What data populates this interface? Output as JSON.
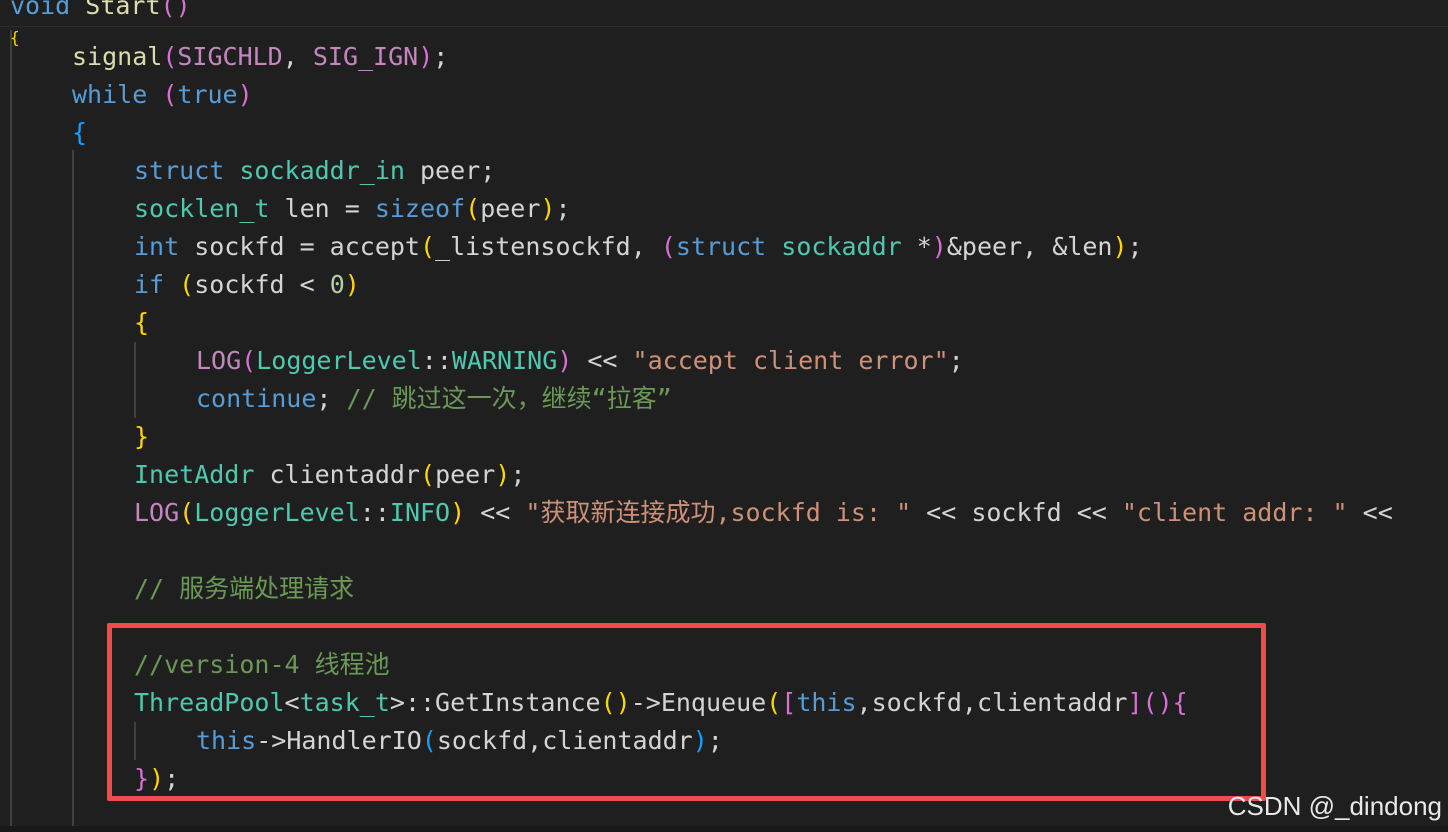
{
  "editor": {
    "lines": [
      {
        "tokens": [
          {
            "t": "void",
            "c": "kw"
          },
          {
            "t": " Start",
            "c": "fn"
          },
          {
            "t": "()",
            "c": "p2"
          }
        ]
      },
      {
        "tokens": [
          {
            "t": "{",
            "c": "p1"
          }
        ]
      },
      {
        "tokens": [
          {
            "t": "signal",
            "c": "fn"
          },
          {
            "t": "(",
            "c": "p2"
          },
          {
            "t": "SIGCHLD",
            "c": "ctl"
          },
          {
            "t": ", ",
            "c": "pl"
          },
          {
            "t": "SIG_IGN",
            "c": "ctl"
          },
          {
            "t": ")",
            "c": "p2"
          },
          {
            "t": ";",
            "c": "pl"
          }
        ]
      },
      {
        "tokens": [
          {
            "t": "while",
            "c": "kw"
          },
          {
            "t": " ",
            "c": "pl"
          },
          {
            "t": "(",
            "c": "p2"
          },
          {
            "t": "true",
            "c": "kw"
          },
          {
            "t": ")",
            "c": "p2"
          }
        ]
      },
      {
        "tokens": [
          {
            "t": "{",
            "c": "p3"
          }
        ]
      },
      {
        "tokens": [
          {
            "t": "struct",
            "c": "kw"
          },
          {
            "t": " ",
            "c": "pl"
          },
          {
            "t": "sockaddr_in",
            "c": "ty"
          },
          {
            "t": " peer;",
            "c": "pl"
          }
        ]
      },
      {
        "tokens": [
          {
            "t": "socklen_t",
            "c": "ty"
          },
          {
            "t": " len = ",
            "c": "pl"
          },
          {
            "t": "sizeof",
            "c": "kw"
          },
          {
            "t": "(",
            "c": "p1"
          },
          {
            "t": "peer",
            "c": "pl"
          },
          {
            "t": ")",
            "c": "p1"
          },
          {
            "t": ";",
            "c": "pl"
          }
        ]
      },
      {
        "tokens": [
          {
            "t": "int",
            "c": "kw"
          },
          {
            "t": " sockfd = accept",
            "c": "pl"
          },
          {
            "t": "(",
            "c": "p1"
          },
          {
            "t": "_listensockfd, ",
            "c": "pl"
          },
          {
            "t": "(",
            "c": "p2"
          },
          {
            "t": "struct",
            "c": "kw"
          },
          {
            "t": " ",
            "c": "pl"
          },
          {
            "t": "sockaddr",
            "c": "ty"
          },
          {
            "t": " *",
            "c": "pl"
          },
          {
            "t": ")",
            "c": "p2"
          },
          {
            "t": "&peer, &len",
            "c": "pl"
          },
          {
            "t": ")",
            "c": "p1"
          },
          {
            "t": ";",
            "c": "pl"
          }
        ]
      },
      {
        "tokens": [
          {
            "t": "if",
            "c": "kw"
          },
          {
            "t": " ",
            "c": "pl"
          },
          {
            "t": "(",
            "c": "p1"
          },
          {
            "t": "sockfd < ",
            "c": "pl"
          },
          {
            "t": "0",
            "c": "num"
          },
          {
            "t": ")",
            "c": "p1"
          }
        ]
      },
      {
        "tokens": [
          {
            "t": "{",
            "c": "p1"
          }
        ]
      },
      {
        "tokens": [
          {
            "t": "LOG",
            "c": "ctl"
          },
          {
            "t": "(",
            "c": "p2"
          },
          {
            "t": "LoggerLevel",
            "c": "ty"
          },
          {
            "t": "::",
            "c": "pl"
          },
          {
            "t": "WARNING",
            "c": "ty"
          },
          {
            "t": ")",
            "c": "p2"
          },
          {
            "t": " << ",
            "c": "pl"
          },
          {
            "t": "\"accept client error\"",
            "c": "str"
          },
          {
            "t": ";",
            "c": "pl"
          }
        ]
      },
      {
        "tokens": [
          {
            "t": "continue",
            "c": "kw"
          },
          {
            "t": "; ",
            "c": "pl"
          },
          {
            "t": "// 跳过这一次，继续“拉客”",
            "c": "cmt"
          }
        ]
      },
      {
        "tokens": [
          {
            "t": "}",
            "c": "p1"
          }
        ]
      },
      {
        "tokens": [
          {
            "t": "InetAddr",
            "c": "ty"
          },
          {
            "t": " clientaddr",
            "c": "pl"
          },
          {
            "t": "(",
            "c": "p1"
          },
          {
            "t": "peer",
            "c": "pl"
          },
          {
            "t": ")",
            "c": "p1"
          },
          {
            "t": ";",
            "c": "pl"
          }
        ]
      },
      {
        "tokens": [
          {
            "t": "LOG",
            "c": "ctl"
          },
          {
            "t": "(",
            "c": "p1"
          },
          {
            "t": "LoggerLevel",
            "c": "ty"
          },
          {
            "t": "::",
            "c": "pl"
          },
          {
            "t": "INFO",
            "c": "ty"
          },
          {
            "t": ")",
            "c": "p1"
          },
          {
            "t": " << ",
            "c": "pl"
          },
          {
            "t": "\"获取新连接成功,sockfd is: \"",
            "c": "str"
          },
          {
            "t": " << sockfd << ",
            "c": "pl"
          },
          {
            "t": "\"client addr: \"",
            "c": "str"
          },
          {
            "t": " <<",
            "c": "pl"
          }
        ]
      },
      {
        "tokens": []
      },
      {
        "tokens": [
          {
            "t": "// 服务端处理请求",
            "c": "cmt"
          }
        ]
      },
      {
        "tokens": []
      },
      {
        "tokens": [
          {
            "t": "//version-4 线程池",
            "c": "cmt"
          }
        ]
      },
      {
        "tokens": [
          {
            "t": "ThreadPool",
            "c": "ty"
          },
          {
            "t": "<",
            "c": "pl"
          },
          {
            "t": "task_t",
            "c": "ty"
          },
          {
            "t": ">::GetInstance",
            "c": "pl"
          },
          {
            "t": "()",
            "c": "p1"
          },
          {
            "t": "->Enqueue",
            "c": "pl"
          },
          {
            "t": "(",
            "c": "p1"
          },
          {
            "t": "[",
            "c": "p2"
          },
          {
            "t": "this",
            "c": "kw"
          },
          {
            "t": ",sockfd,clientaddr",
            "c": "pl"
          },
          {
            "t": "]",
            "c": "p2"
          },
          {
            "t": "()",
            "c": "p2"
          },
          {
            "t": "{",
            "c": "p2"
          }
        ]
      },
      {
        "tokens": [
          {
            "t": "this",
            "c": "kw"
          },
          {
            "t": "->HandlerIO",
            "c": "pl"
          },
          {
            "t": "(",
            "c": "p3"
          },
          {
            "t": "sockfd,clientaddr",
            "c": "pl"
          },
          {
            "t": ")",
            "c": "p3"
          },
          {
            "t": ";",
            "c": "pl"
          }
        ]
      },
      {
        "tokens": [
          {
            "t": "}",
            "c": "p2"
          },
          {
            "t": ")",
            "c": "p1"
          },
          {
            "t": ";",
            "c": "pl"
          }
        ]
      }
    ]
  },
  "watermark": "CSDN @_dindong",
  "colors": {
    "highlight_border": "#f04b4f",
    "background": "#1f1f1f"
  }
}
